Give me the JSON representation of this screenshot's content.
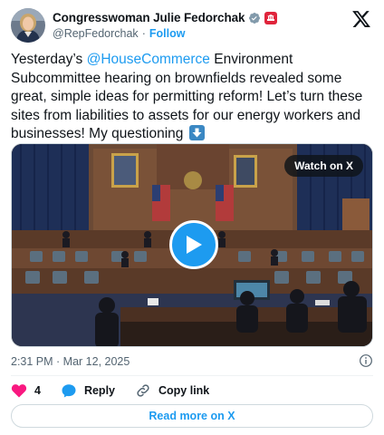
{
  "author": {
    "display_name": "Congresswoman Julie Fedorchak",
    "handle": "@RepFedorchak",
    "separator": "·",
    "follow_label": "Follow"
  },
  "tweet": {
    "text_1": "Yesterday’s ",
    "mention": "@HouseCommerce",
    "text_2": " Environment Subcommittee hearing on brownfields revealed some great, simple ideas for permitting reform! Let’s turn these sites from liabilities to assets for our energy workers and businesses! My questioning ",
    "emoji": "down-arrow-emoji"
  },
  "media": {
    "watch_label": "Watch on X"
  },
  "meta": {
    "timestamp": "2:31 PM · Mar 12, 2025"
  },
  "actions": {
    "likes": "4",
    "reply_label": "Reply",
    "copy_label": "Copy link"
  },
  "footer": {
    "read_more_label": "Read more on X"
  },
  "colors": {
    "accent": "#1d9bf0",
    "like": "#f91880",
    "text": "#0f1419",
    "muted": "#536471"
  },
  "icons": [
    "x-logo-icon",
    "verified-badge-icon",
    "affiliation-badge-icon",
    "play-icon",
    "info-icon",
    "heart-icon",
    "reply-bubble-icon",
    "link-icon"
  ]
}
